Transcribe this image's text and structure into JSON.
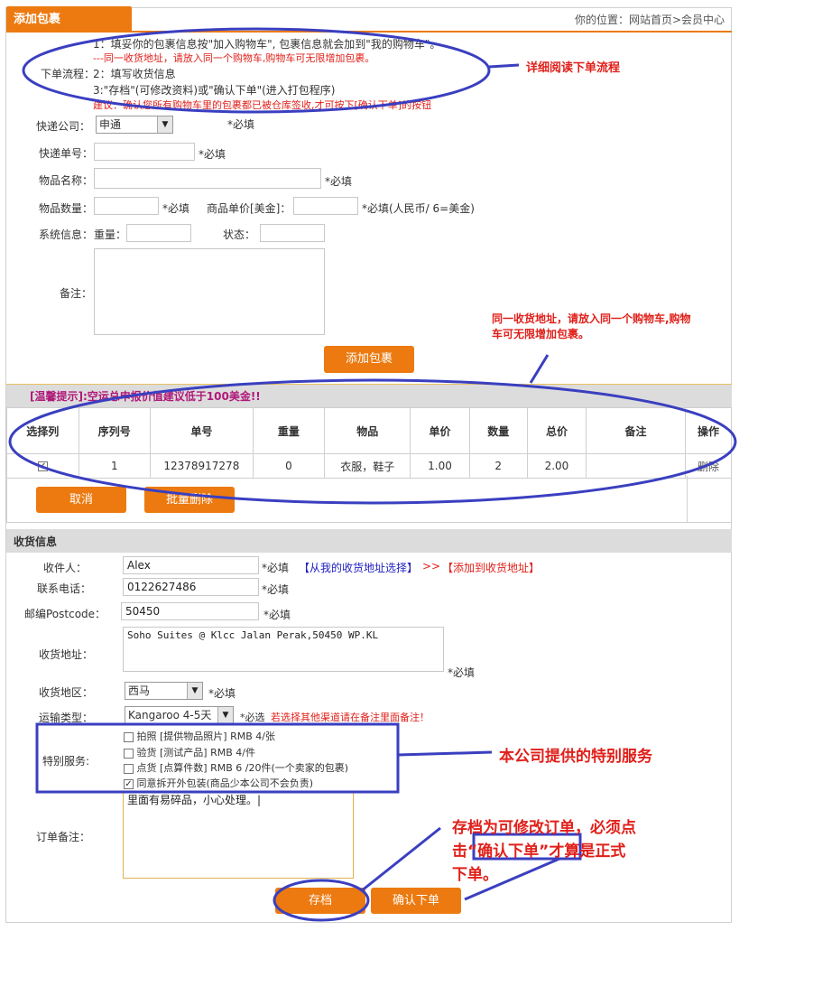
{
  "header": {
    "tab_title": "添加包裹",
    "breadcrumb": "你的位置：网站首页>会员中心"
  },
  "process": {
    "line1": "1：填妥你的包裹信息按\"加入购物车\", 包裹信息就会加到\"我的购物车\"。",
    "line1_note": "---同一收货地址，请放入同一个购物车,购物车可无限增加包裹。",
    "label": "下单流程：",
    "line2": "2：填写收货信息",
    "line3": "3:\"存档\"(可修改资料)或\"确认下单\"(进入打包程序)",
    "line4": "建议：确认您所有购物车里的包裹都已被仓库签收,才可按下[确认下单]的按钮"
  },
  "form": {
    "courier_label": "快递公司：",
    "courier_value": "申通",
    "courier_req": "*必填",
    "tracking_label": "快递单号：",
    "tracking_req": "*必填",
    "item_name_label": "物品名称：",
    "item_name_req": "*必填",
    "qty_label": "物品数量：",
    "qty_req": "*必填",
    "unit_price_label": "商品单价[美金]：",
    "unit_price_req": "*必填(人民币/ 6=美金)",
    "sysinfo_label": "系统信息：",
    "weight_label": "重量：",
    "status_label": "状态：",
    "remark_label": "备注：",
    "add_button": "添加包裹"
  },
  "tip": "[温馨提示]:空运总申报价值建议低于100美金!!",
  "table": {
    "headers": [
      "选择列",
      "序列号",
      "单号",
      "重量",
      "物品",
      "单价",
      "数量",
      "总价",
      "备注",
      "操作"
    ],
    "rows": [
      {
        "checked": "✓",
        "seq": "1",
        "number": "12378917278",
        "weight": "0",
        "item": "衣服，鞋子",
        "price": "1.00",
        "qty": "2",
        "total": "2.00",
        "note": "",
        "op": "删除"
      }
    ],
    "cancel_button": "取消",
    "batch_delete_button": "批量删除"
  },
  "shipping": {
    "section_title": "收货信息",
    "recipient_label": "收件人：",
    "recipient_value": "Alex",
    "recipient_req": "*必填",
    "choose_link": "【从我的收货地址选择】",
    "sep": ">>",
    "add_link": "【添加到收货地址】",
    "phone_label": "联系电话：",
    "phone_value": "0122627486",
    "phone_req": "*必填",
    "postcode_label": "邮编Postcode：",
    "postcode_value": "50450",
    "postcode_req": "*必填",
    "address_label": "收货地址：",
    "address_value": "Soho Suites @ Klcc Jalan Perak,50450 WP.KL",
    "address_req": "*必填",
    "region_label": "收货地区：",
    "region_value": "西马",
    "region_req": "*必填",
    "transport_label": "运输类型：",
    "transport_value": "Kangaroo 4-5天",
    "transport_req": "*必选",
    "transport_note": "若选择其他渠道请在备注里面备注！",
    "special_label": "特别服务:",
    "services": [
      {
        "label": "拍照 [提供物品照片] RMB 4/张",
        "checked": ""
      },
      {
        "label": "验货 [测试产品] RMB 4/件",
        "checked": ""
      },
      {
        "label": "点货 [点算件数] RMB 6 /20件(一个卖家的包裹)",
        "checked": ""
      },
      {
        "label": "同意拆开外包装(商品少本公司不会负责)",
        "checked": "✓"
      }
    ],
    "order_note_label": "订单备注：",
    "order_note_value": "里面有易碎品，小心处理。|",
    "save_button": "存档",
    "confirm_button": "确认下单"
  },
  "annotations": {
    "read_process": "详细阅读下单流程",
    "same_address_1": "同一收货地址，请放入同一个购物车,购物",
    "same_address_2": "车可无限增加包裹。",
    "special_service": "本公司提供的特别服务",
    "save_note_1": "存档为可修改订单，必须点",
    "save_note_2a": "击",
    "save_note_2b": "“确认下单”",
    "save_note_2c": "才算是正式",
    "save_note_3": "下单。"
  },
  "colors": {
    "accent": "#ec7a10",
    "annotation_blue": "#3a3fc0",
    "annotation_red": "#e0201a",
    "tip_purple": "#b0187a"
  }
}
